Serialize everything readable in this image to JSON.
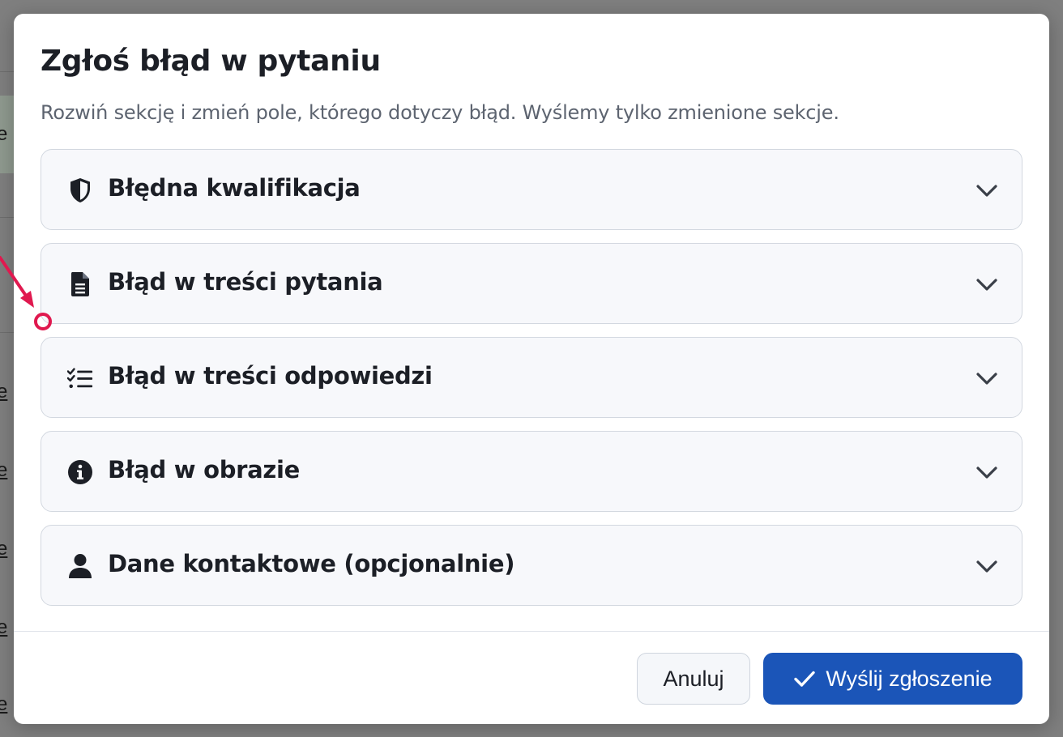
{
  "background": {
    "letters": [
      "e",
      "e",
      "e",
      "e",
      "e",
      "e",
      "e"
    ]
  },
  "dialog": {
    "title": "Zgłoś błąd w pytaniu",
    "subtitle": "Rozwiń sekcję i zmień pole, którego dotyczy błąd. Wyślemy tylko zmienione sekcje.",
    "sections": [
      {
        "label": "Błędna kwalifikacja",
        "icon": "shield-icon",
        "expanded": false
      },
      {
        "label": "Błąd w treści pytania",
        "icon": "document-icon",
        "expanded": false
      },
      {
        "label": "Błąd w treści odpowiedzi",
        "icon": "checklist-icon",
        "expanded": false
      },
      {
        "label": "Błąd w obrazie",
        "icon": "info-icon",
        "expanded": false
      },
      {
        "label": "Dane kontaktowe (opcjonalnie)",
        "icon": "user-icon",
        "expanded": false
      }
    ],
    "cancel_label": "Anuluj",
    "submit_label": "Wyślij zgłoszenie"
  },
  "colors": {
    "accent": "#1b55b8",
    "annotation": "#e0194f",
    "section_bg": "#f7f8fb",
    "overlay": "#7f7f7f"
  }
}
